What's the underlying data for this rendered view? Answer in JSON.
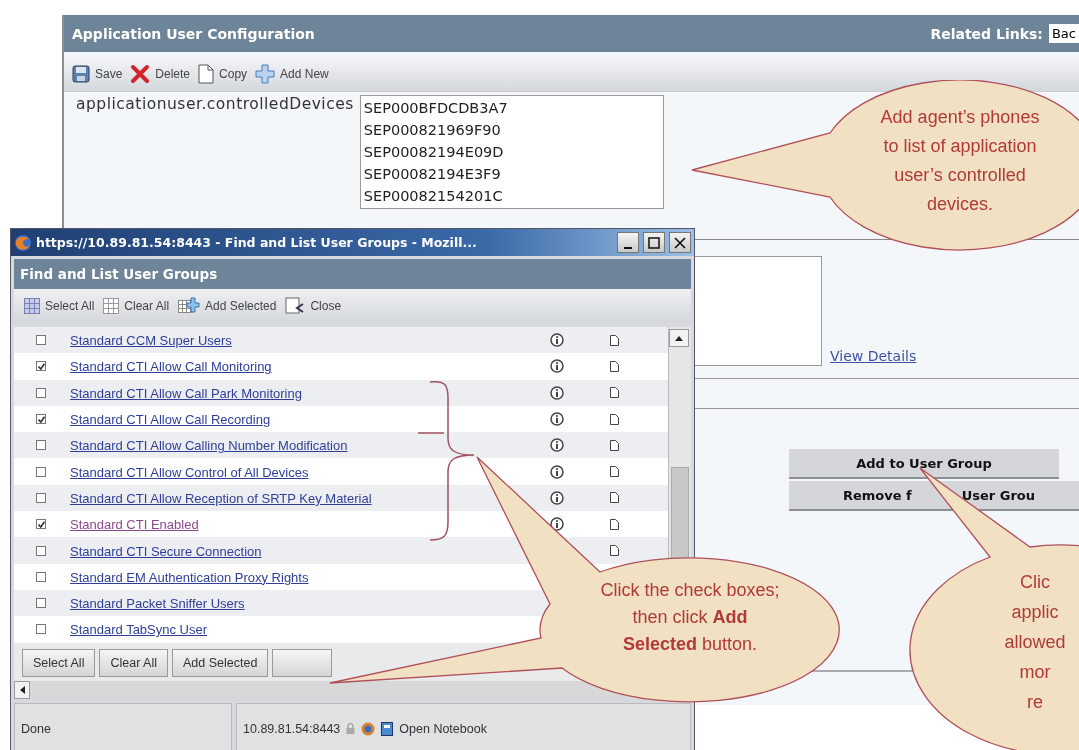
{
  "main_window": {
    "title": "Application User Configuration",
    "related_links": {
      "label": "Related Links:",
      "value": "Bac"
    },
    "toolbar": [
      {
        "kind": "save",
        "label": "Save"
      },
      {
        "kind": "delete",
        "label": "Delete"
      },
      {
        "kind": "copy",
        "label": "Copy"
      },
      {
        "kind": "add",
        "label": "Add New"
      }
    ],
    "field": {
      "label": "applicationuser.controlledDevices",
      "devices": [
        "SEP000BFDCDB3A7",
        "SEP000821969F90",
        "SEP00082194E09D",
        "SEP00082194E3F9",
        "SEP00082154201C"
      ]
    },
    "view_details_link": "View Details",
    "buttons": [
      {
        "label_parts": [
          "Add to User Group"
        ]
      },
      {
        "label_parts": [
          "Remove f",
          "User Grou"
        ]
      }
    ]
  },
  "popup": {
    "title": "https://10.89.81.54:8443 - Find and List User Groups - Mozill...",
    "heading": "Find and List User Groups",
    "toolbar": [
      {
        "kind": "select_all",
        "label": "Select All"
      },
      {
        "kind": "clear_all",
        "label": "Clear All"
      },
      {
        "kind": "add_selected",
        "label": "Add Selected"
      },
      {
        "kind": "close",
        "label": "Close"
      }
    ],
    "groups": [
      {
        "name": "Standard CCM Super Users",
        "checked": false,
        "visited": false
      },
      {
        "name": "Standard CTI Allow Call Monitoring",
        "checked": true,
        "visited": false
      },
      {
        "name": "Standard CTI Allow Call Park Monitoring",
        "checked": false,
        "visited": false
      },
      {
        "name": "Standard CTI Allow Call Recording",
        "checked": true,
        "visited": false
      },
      {
        "name": "Standard CTI Allow Calling Number Modification",
        "checked": false,
        "visited": false
      },
      {
        "name": "Standard CTI Allow Control of All Devices",
        "checked": false,
        "visited": false
      },
      {
        "name": "Standard CTI Allow Reception of SRTP Key Material",
        "checked": false,
        "visited": false
      },
      {
        "name": "Standard CTI Enabled",
        "checked": true,
        "visited": true
      },
      {
        "name": "Standard CTI Secure Connection",
        "checked": false,
        "visited": false
      },
      {
        "name": "Standard EM Authentication Proxy Rights",
        "checked": false,
        "visited": false
      },
      {
        "name": "Standard Packet Sniffer Users",
        "checked": false,
        "visited": false
      },
      {
        "name": "Standard TabSync User",
        "checked": false,
        "visited": false
      }
    ],
    "buttons": [
      "Select All",
      "Clear All",
      "Add Selected"
    ],
    "status_bar": {
      "text": "Done",
      "address": "10.89.81.54:8443",
      "notebook": "Open Notebook"
    }
  },
  "callouts": [
    {
      "lines": [
        "Add agent’s phones",
        "to list of application",
        "user’s controlled",
        "devices."
      ]
    },
    {
      "lines": [
        "Click the check boxes;",
        "then click **Add**",
        "**Selected** button."
      ]
    },
    {
      "lines": [
        "Clic",
        "applic",
        "allowed",
        "mor",
        "re"
      ]
    }
  ]
}
